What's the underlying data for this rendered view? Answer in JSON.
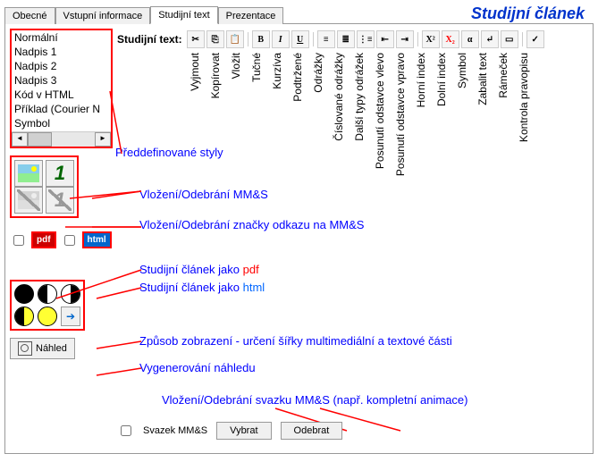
{
  "tabs": {
    "items": [
      "Obecné",
      "Vstupní informace",
      "Studijní text",
      "Prezentace"
    ],
    "active_index": 2
  },
  "page_title": "Studijní článek",
  "style_list": [
    "Normální",
    "Nadpis 1",
    "Nadpis 2",
    "Nadpis 3",
    "Kód v HTML",
    "Příklad (Courier N",
    "Symbol"
  ],
  "label_studijni_text": "Studijní text:",
  "toolbar_tooltips": [
    "Vyjmout",
    "Kopírovat",
    "Vložit",
    "Tučné",
    "Kurzíva",
    "Podtržené",
    "Odrážky",
    "Číslované odrážky",
    "Další typy odrážek",
    "Posunutí odstavce vlevo",
    "Posunutí odstavce vpravo",
    "Horní index",
    "Dolní index",
    "Symbol",
    "Zabalit text",
    "Rámeček",
    "Kontrola pravopisu"
  ],
  "annotations": {
    "predef_styles": "Předdefinované styly",
    "mm_insert": "Vložení/Odebrání MM&S",
    "mm_ref": "Vložení/Odebrání značky odkazu na MM&S",
    "as_pdf_pre": "Studijní článek jako ",
    "pdf_word": "pdf",
    "as_html_pre": "Studijní článek jako ",
    "html_word": "html",
    "display_width": "Způsob zobrazení - určení šířky multimediální a textové části",
    "gen_preview": "Vygenerování náhledu",
    "bundle_insert": "Vložení/Odebrání svazku MM&S (např. kompletní animace)"
  },
  "badges": {
    "pdf": "pdf",
    "html": "html"
  },
  "buttons": {
    "nahled": "Náhled",
    "vybrat": "Vybrat",
    "odebrat": "Odebrat"
  },
  "checkbox_svazek": "Svazek MM&S"
}
